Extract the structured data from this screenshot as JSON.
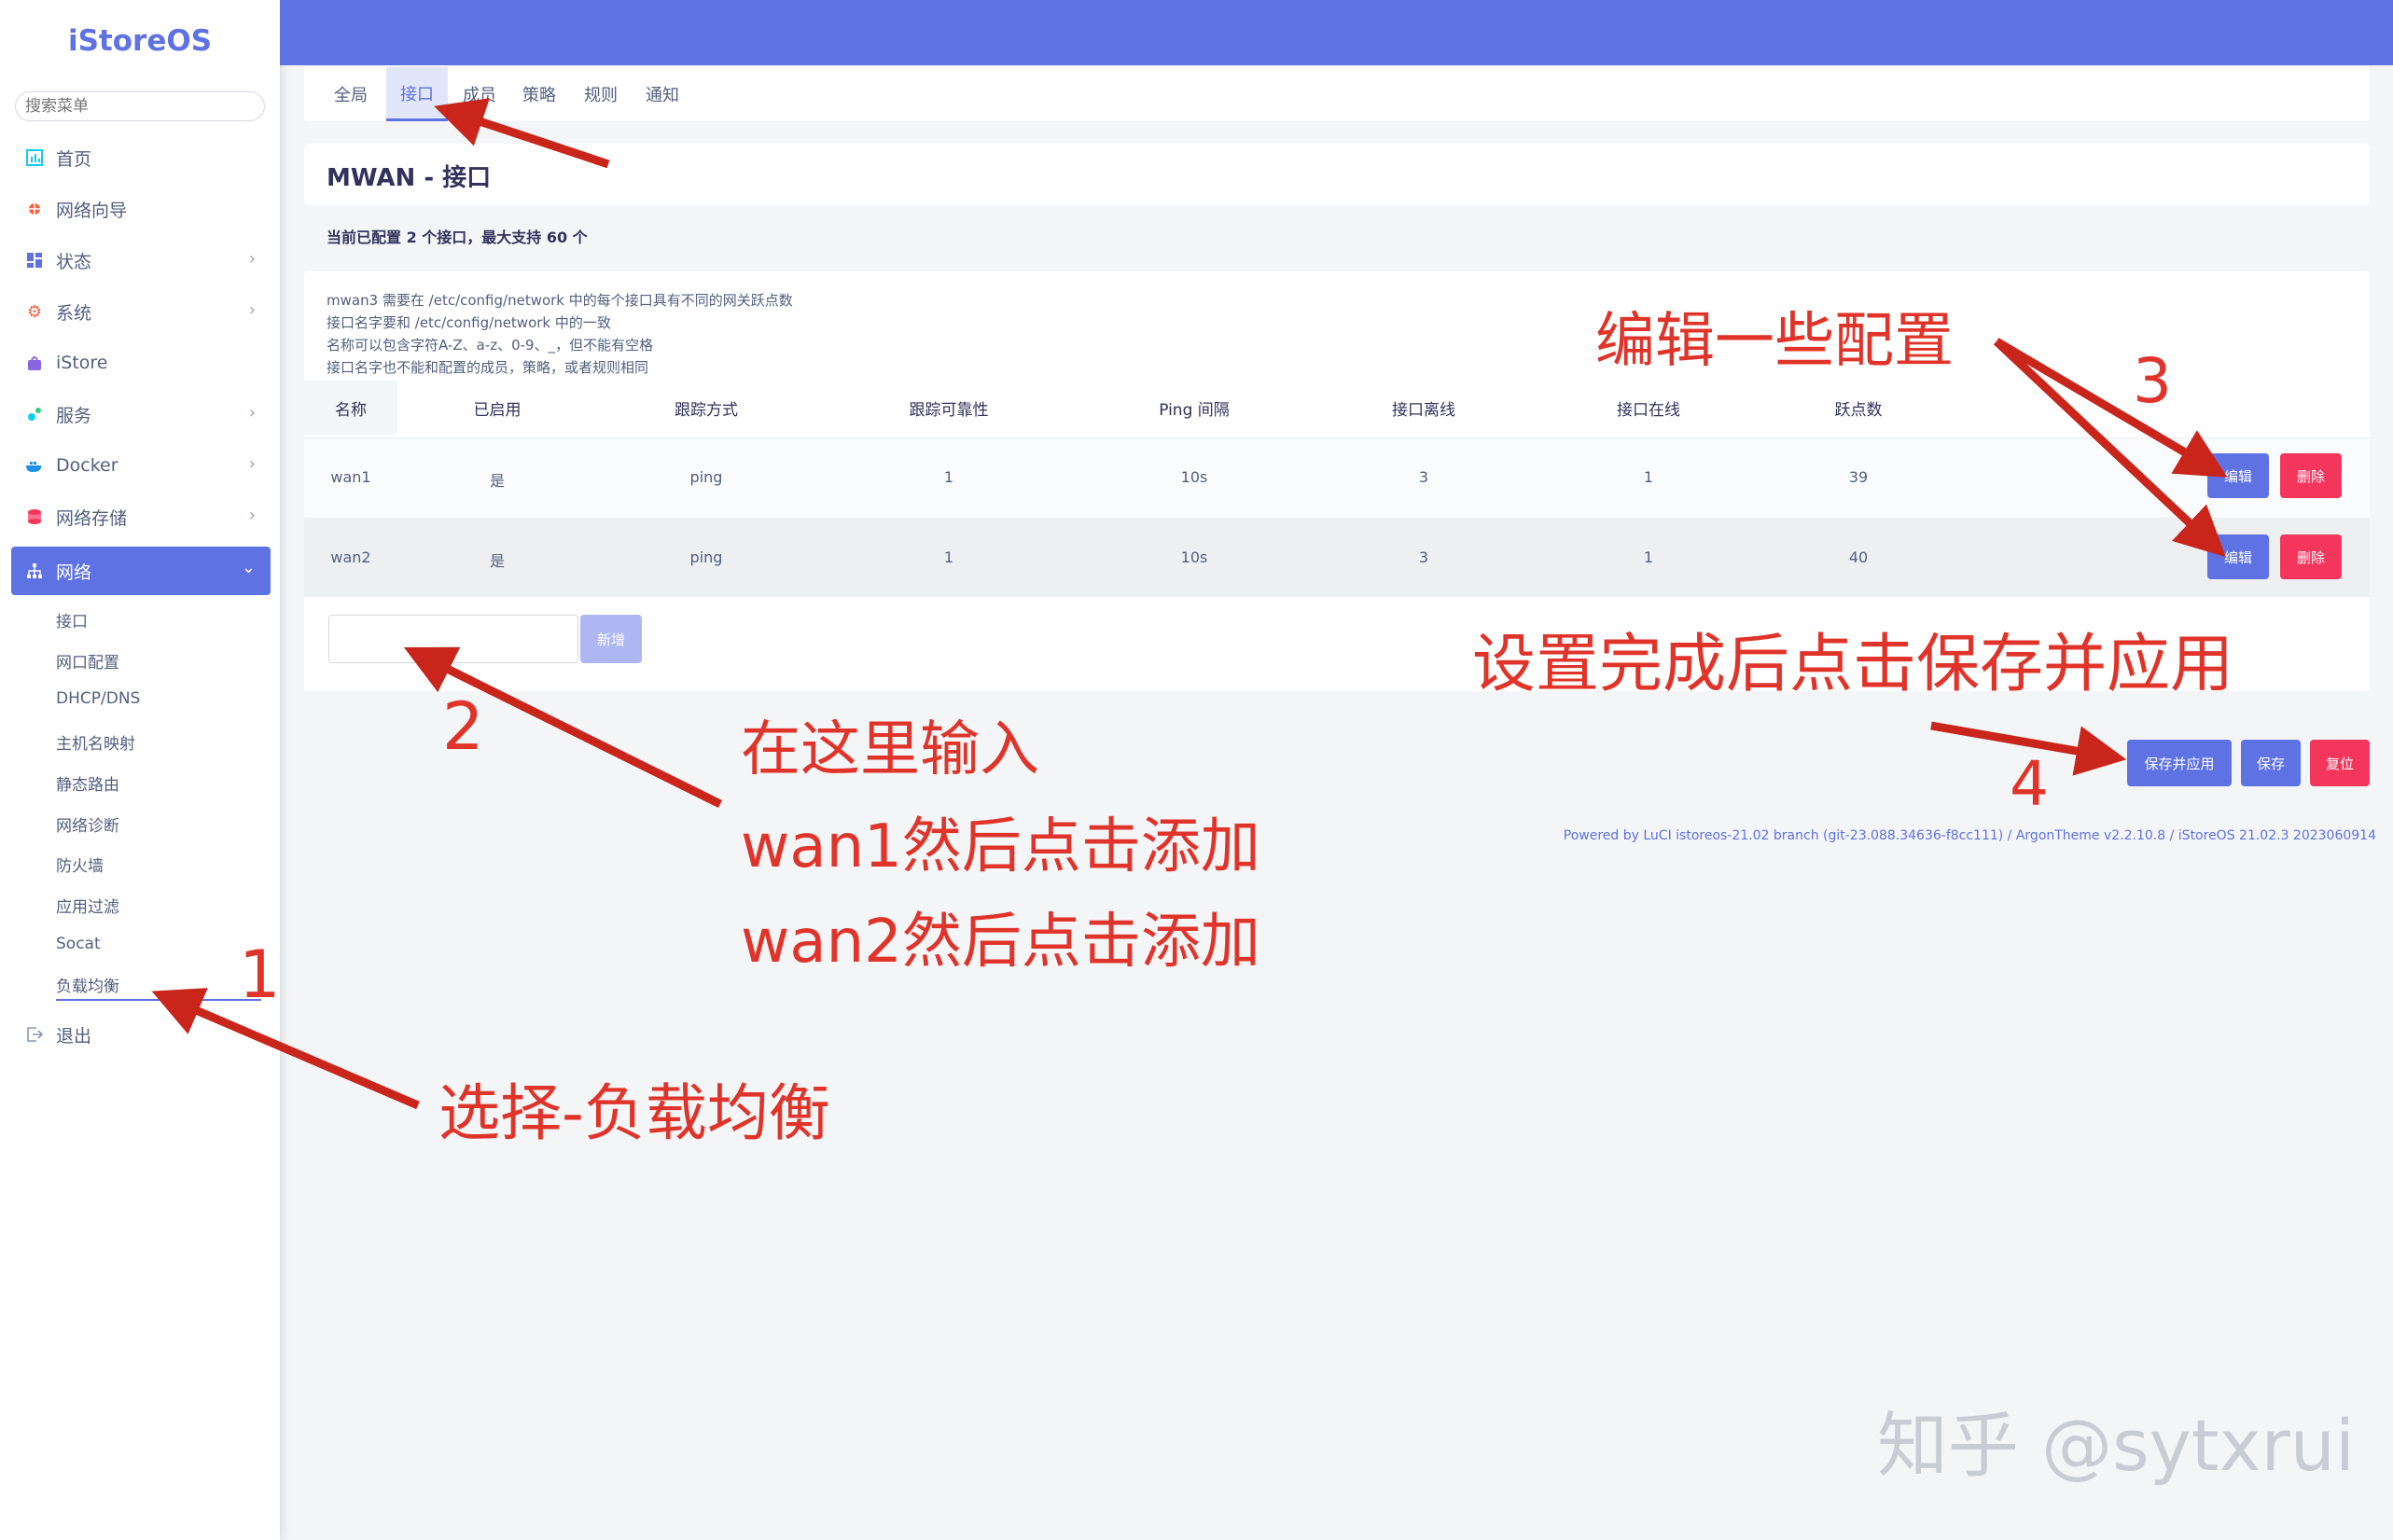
{
  "sidebar": {
    "brand": "iStoreOS",
    "search_placeholder": "搜索菜单",
    "items": [
      {
        "label": "首页",
        "icon": "dashboard-icon"
      },
      {
        "label": "网络向导",
        "icon": "wizard-icon"
      },
      {
        "label": "状态",
        "icon": "status-grid-icon"
      },
      {
        "label": "系统",
        "icon": "gear-icon"
      },
      {
        "label": "iStore",
        "icon": "store-icon"
      },
      {
        "label": "服务",
        "icon": "services-icon"
      },
      {
        "label": "Docker",
        "icon": "docker-icon"
      },
      {
        "label": "网络存储",
        "icon": "storage-icon"
      },
      {
        "label": "网络",
        "icon": "network-icon"
      }
    ],
    "subitems": [
      "接口",
      "网口配置",
      "DHCP/DNS",
      "主机名映射",
      "静态路由",
      "网络诊断",
      "防火墙",
      "应用过滤",
      "Socat",
      "负载均衡"
    ],
    "logout": "退出"
  },
  "tabs": [
    "全局",
    "接口",
    "成员",
    "策略",
    "规则",
    "通知"
  ],
  "page_title": "MWAN - 接口",
  "config_note": "当前已配置 2 个接口，最大支持 60 个",
  "description": [
    "mwan3 需要在 /etc/config/network 中的每个接口具有不同的网关跃点数",
    "接口名字要和 /etc/config/network 中的一致",
    "名称可以包含字符A-Z、a-z、0-9、_，但不能有空格",
    "接口名字也不能和配置的成员，策略，或者规则相同"
  ],
  "table": {
    "headers": [
      "名称",
      "已启用",
      "跟踪方式",
      "跟踪可靠性",
      "Ping 间隔",
      "接口离线",
      "接口在线",
      "跃点数"
    ],
    "rows": [
      [
        "wan1",
        "是",
        "ping",
        "1",
        "10s",
        "3",
        "1",
        "39"
      ],
      [
        "wan2",
        "是",
        "ping",
        "1",
        "10s",
        "3",
        "1",
        "40"
      ]
    ],
    "edit_label": "编辑",
    "delete_label": "删除"
  },
  "add_label": "新增",
  "actions": {
    "save_apply": "保存并应用",
    "save": "保存",
    "reset": "复位"
  },
  "footer": "Powered by LuCI istoreos-21.02 branch (git-23.088.34636-f8cc111) / ArgonTheme v2.2.10.8 / iStoreOS 21.02.3 2023060914",
  "annotations": {
    "edit_config": "编辑一些配置",
    "save_hint": "设置完成后点击保存并应用",
    "input_here": "在这里输入",
    "wan1_add": "wan1然后点击添加",
    "wan2_add": "wan2然后点击添加",
    "select_lb": "选择-负载均衡",
    "num1": "1",
    "num2": "2",
    "num3": "3",
    "num4": "4"
  },
  "watermark": "知乎 @sytxrui",
  "colors": {
    "accent": "#5e72e4",
    "danger": "#f5365c",
    "annotation": "#e0342a"
  }
}
